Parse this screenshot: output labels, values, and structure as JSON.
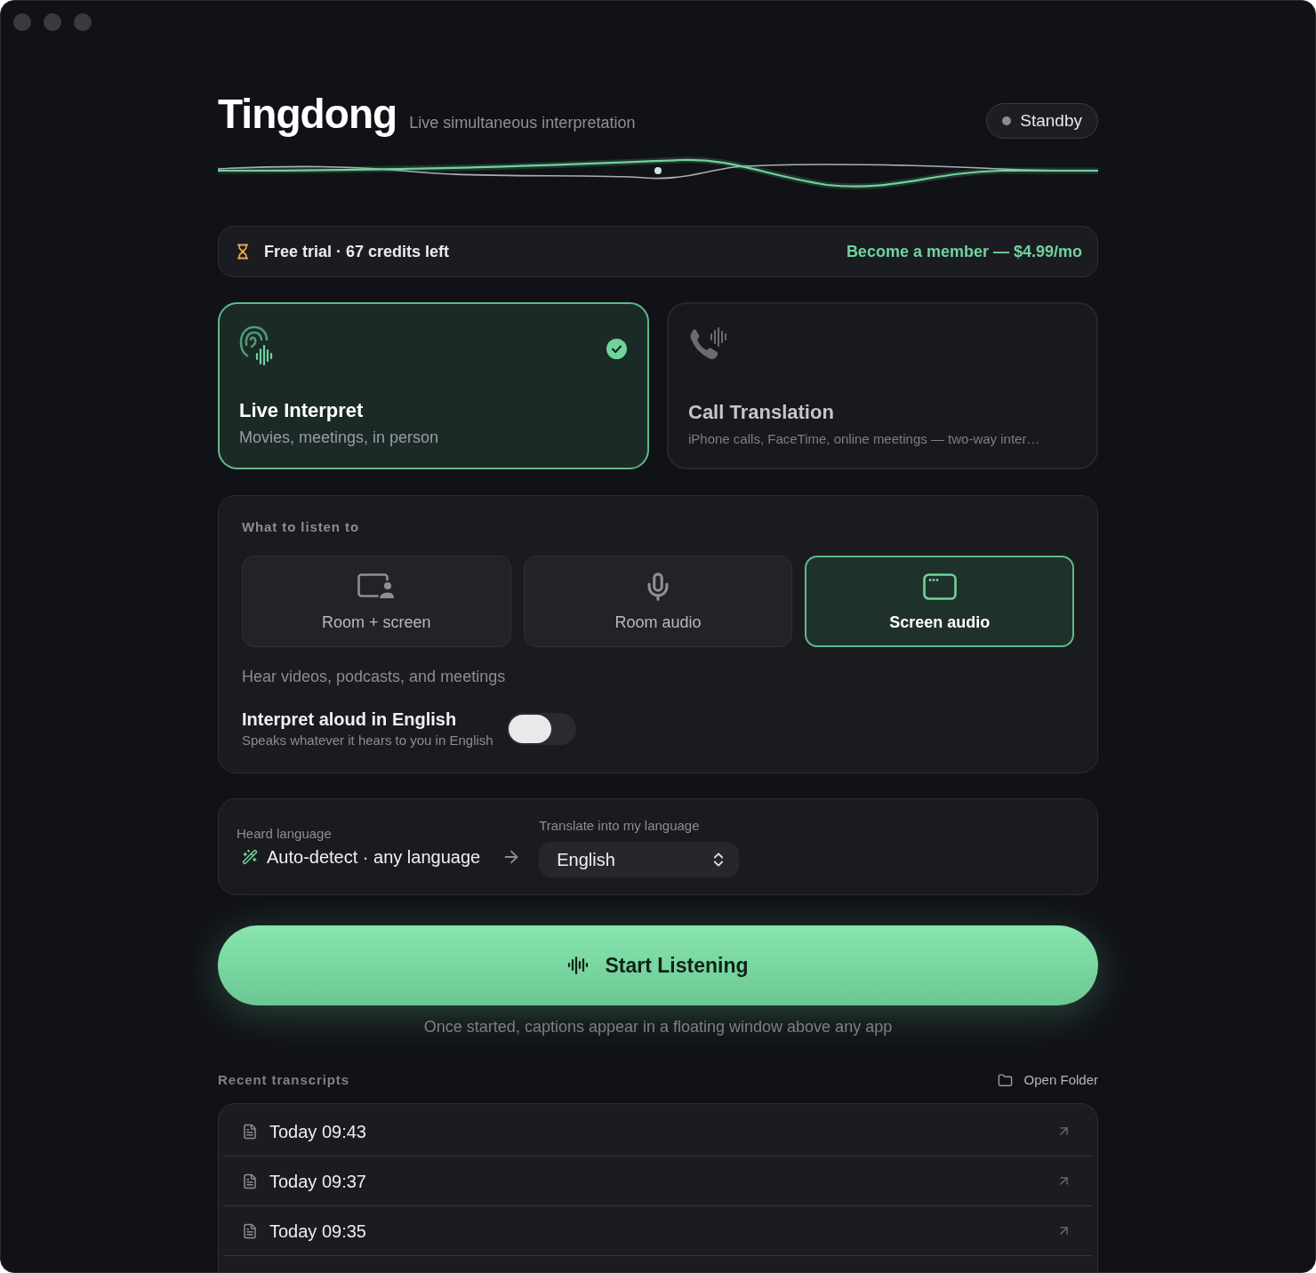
{
  "header": {
    "title": "Tingdong",
    "subtitle": "Live simultaneous interpretation",
    "status": {
      "label": "Standby",
      "active": false
    }
  },
  "trial": {
    "label": "Free trial · 67 credits left",
    "link": "Become a member — $4.99/mo"
  },
  "modes": [
    {
      "kind": "ear",
      "title": "Live Interpret",
      "subtitle": "Movies, meetings, in person",
      "selected": true
    },
    {
      "kind": "phone",
      "title": "Call Translation",
      "subtitle": "iPhone calls, FaceTime, online meetings — two-way inter…",
      "selected": false
    }
  ],
  "listen": {
    "heading": "What to listen to",
    "sources": [
      {
        "kind": "room_screen",
        "label": "Room + screen",
        "selected": false
      },
      {
        "kind": "room",
        "label": "Room audio",
        "selected": false
      },
      {
        "kind": "screen",
        "label": "Screen audio",
        "selected": true
      }
    ],
    "hint": "Hear videos, podcasts, and meetings",
    "aloud": {
      "label": "Interpret aloud in English",
      "description": "Speaks whatever it hears to you in English",
      "on": false
    }
  },
  "languages": {
    "heard": {
      "label": "Heard language",
      "value": "Auto-detect · any language"
    },
    "target": {
      "label": "Translate into my language",
      "value": "English"
    }
  },
  "start": {
    "label": "Start Listening",
    "caption": "Once started, captions appear in a floating window above any app"
  },
  "recent": {
    "heading": "Recent transcripts",
    "open_folder": "Open Folder",
    "items": [
      {
        "label": "Today 09:43"
      },
      {
        "label": "Today 09:37"
      },
      {
        "label": "Today 09:35"
      }
    ]
  }
}
